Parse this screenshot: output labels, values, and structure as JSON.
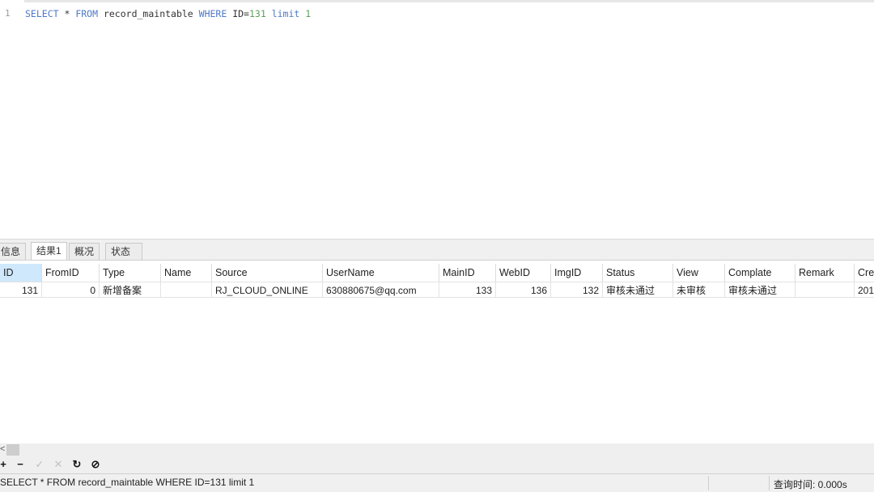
{
  "editor": {
    "line_number": "1",
    "code": {
      "select": "SELECT",
      "star": " * ",
      "from": "FROM",
      "table": " record_maintable ",
      "where": "WHERE",
      "cond": " ID=",
      "id_value": "131",
      "space": " ",
      "limit": "limit",
      "space2": " ",
      "limit_value": "1"
    }
  },
  "tabs": [
    {
      "label": "信息"
    },
    {
      "label": "结果1"
    },
    {
      "label": "概况"
    },
    {
      "label": "状态"
    }
  ],
  "grid": {
    "columns": [
      "ID",
      "FromID",
      "Type",
      "Name",
      "Source",
      "UserName",
      "MainID",
      "WebID",
      "ImgID",
      "Status",
      "View",
      "Complate",
      "Remark",
      "Crea"
    ],
    "row": [
      "131",
      "0",
      "新增备案",
      "",
      "RJ_CLOUD_ONLINE",
      "630880675@qq.com",
      "133",
      "136",
      "132",
      "审核未通过",
      "未审核",
      "审核未通过",
      "",
      "201"
    ]
  },
  "toolbar": {
    "add": "+",
    "remove": "−",
    "apply": "✓",
    "discard": "✕",
    "refresh": "↻",
    "stop": "⊘",
    "scroll_left": "<"
  },
  "status": {
    "sql": "SELECT * FROM record_maintable WHERE ID=131 limit 1",
    "time": "查询时间: 0.000s"
  },
  "colors": {
    "keyword": "#4d79c7",
    "number": "#5aa05a",
    "selected_header": "#cfe8fb"
  }
}
